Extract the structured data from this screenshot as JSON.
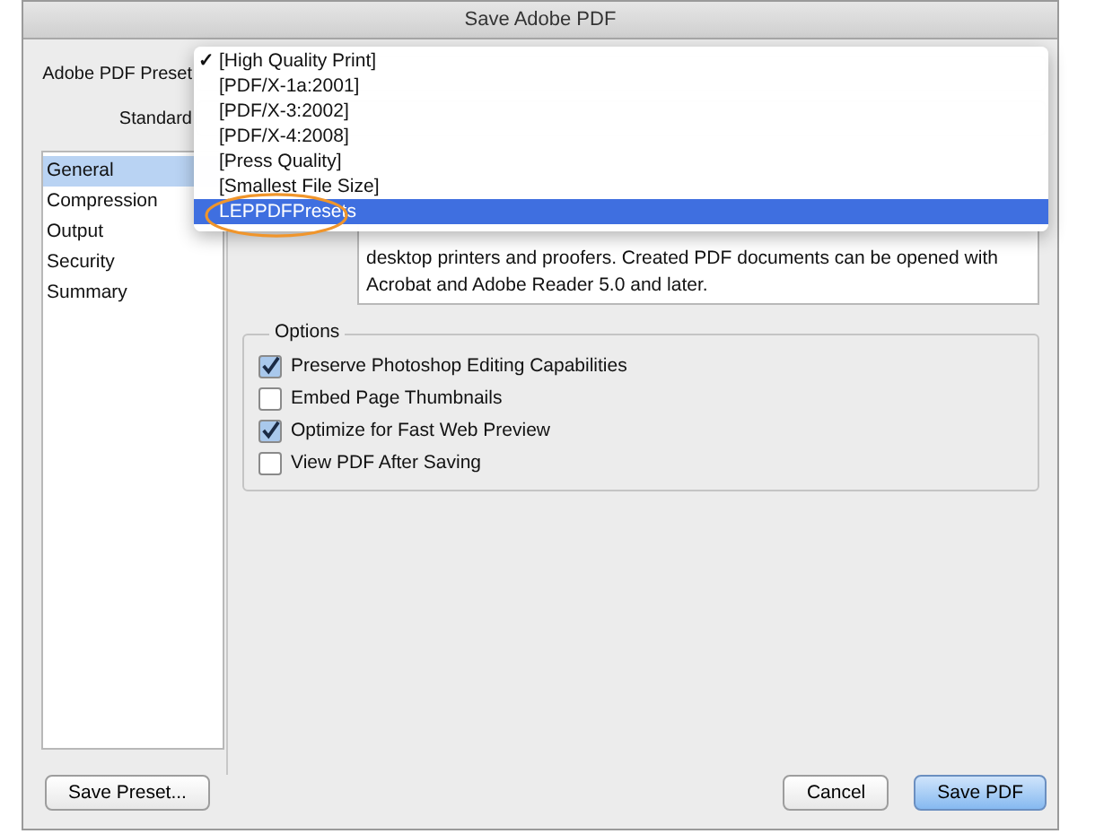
{
  "window": {
    "title": "Save Adobe PDF"
  },
  "preset": {
    "label": "Adobe PDF Preset"
  },
  "standard": {
    "label": "Standard"
  },
  "preset_menu": [
    {
      "label": "[High Quality Print]",
      "checked": true,
      "selected": false
    },
    {
      "label": "[PDF/X-1a:2001]",
      "checked": false,
      "selected": false
    },
    {
      "label": "[PDF/X-3:2002]",
      "checked": false,
      "selected": false
    },
    {
      "label": "[PDF/X-4:2008]",
      "checked": false,
      "selected": false
    },
    {
      "label": "[Press Quality]",
      "checked": false,
      "selected": false
    },
    {
      "label": "[Smallest File Size]",
      "checked": false,
      "selected": false
    },
    {
      "label": "LEPPDFPresets",
      "checked": false,
      "selected": true
    }
  ],
  "check_mark": "✓",
  "sidebar": {
    "items": [
      {
        "label": "General",
        "selected": true
      },
      {
        "label": "Compression",
        "selected": false
      },
      {
        "label": "Output",
        "selected": false
      },
      {
        "label": "Security",
        "selected": false
      },
      {
        "label": "Summary",
        "selected": false
      }
    ]
  },
  "description": "desktop printers and proofers.  Created PDF documents can be opened with Acrobat and Adobe Reader 5.0 and later.",
  "options": {
    "title": "Options",
    "items": [
      {
        "label": "Preserve Photoshop Editing Capabilities",
        "checked": true
      },
      {
        "label": "Embed Page Thumbnails",
        "checked": false
      },
      {
        "label": "Optimize for Fast Web Preview",
        "checked": true
      },
      {
        "label": "View PDF After Saving",
        "checked": false
      }
    ]
  },
  "buttons": [
    {
      "label": "Save Preset...",
      "kind": "normal"
    },
    {
      "label": "Cancel",
      "kind": "normal"
    },
    {
      "label": "Save PDF",
      "kind": "default"
    }
  ]
}
